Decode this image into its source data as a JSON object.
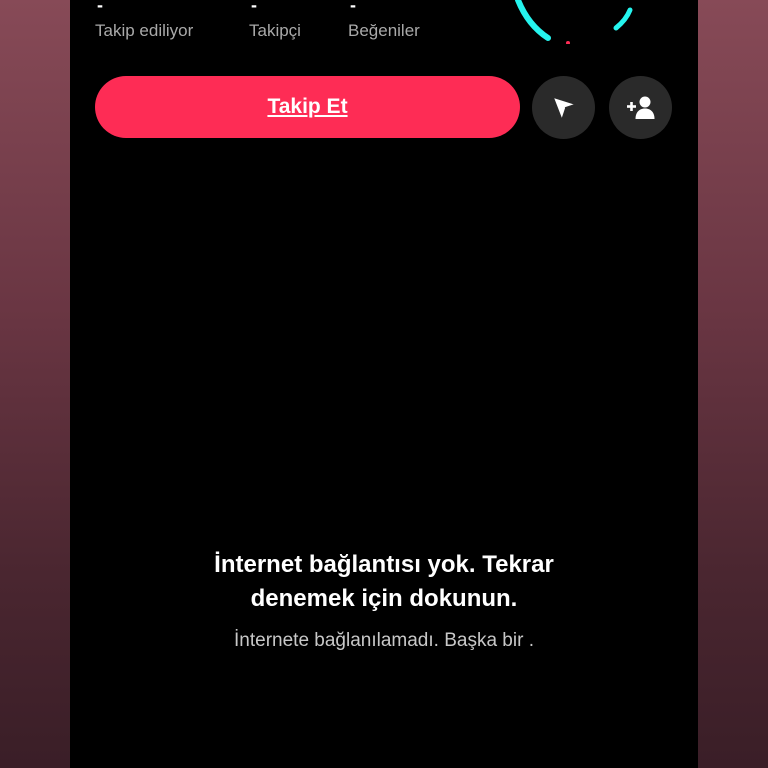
{
  "profile": {
    "stats": [
      {
        "value": "-",
        "label": "Takip ediliyor"
      },
      {
        "value": "-",
        "label": "Takipçi"
      },
      {
        "value": "-",
        "label": "Beğeniler"
      }
    ]
  },
  "actions": {
    "follow_label": "Takip Et",
    "message_icon": "send-arrow-icon",
    "suggest_icon": "add-person-icon"
  },
  "error": {
    "title": "İnternet bağlantısı yok. Tekrar denemek için dokunun.",
    "subtitle": "İnternete bağlanılamadı. Başka bir ."
  },
  "colors": {
    "accent": "#fe2c55",
    "background": "#000000",
    "secondary_button": "#2a2a2a",
    "ring_cyan": "#25f4ee"
  }
}
